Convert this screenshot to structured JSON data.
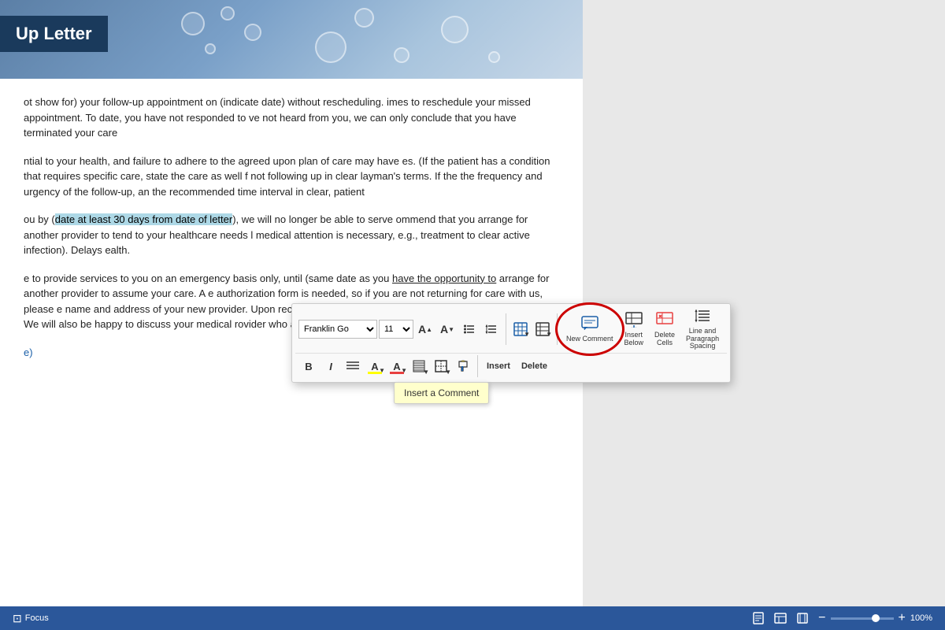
{
  "document": {
    "title": "Up Letter",
    "header_bg": "steelblue",
    "paragraphs": [
      "ot show for) your follow-up appointment on (indicate date) without rescheduling. imes to reschedule your missed appointment. To date, you have not responded to ve not heard from you, we can only conclude that you have terminated your care",
      "ntial to your health, and failure to adhere to the agreed upon plan of care may have es. (If the patient has a condition that requires specific care, state the care as well f not following up in clear layman's terms. If the the frequency and urgency of the follow-up, an the recommended time interval in clear, patient",
      "ou by (date at least 30 days from date of letter), we will no longer be able to serve ommend that you arrange for another provider to tend to your healthcare needs l medical attention is necessary, e.g., treatment to clear active infection). Delays ealth.",
      "e to provide services to you on an emergency basis only, until (same date as you have the opportunity to arrange for another provider to assume your care. A e authorization form is needed, so if you are not returning for care with us, please e name and address of your new provider. Upon receipt of your signed orward a copy of your medical record. We will also be happy to discuss your medical rovider who assumes your care.",
      "e)"
    ],
    "highlighted_phrase": "date at least 30 days from date of letter",
    "underline_phrases": [
      "have the opportunity to"
    ]
  },
  "toolbar": {
    "font_name": "Franklin Go",
    "font_size": "11",
    "buttons_row1": [
      {
        "id": "increase-font",
        "icon": "A↑",
        "label": ""
      },
      {
        "id": "decrease-font",
        "icon": "A↓",
        "label": ""
      },
      {
        "id": "bullets",
        "icon": "≡•",
        "label": ""
      },
      {
        "id": "line-spacing",
        "icon": "≡↕",
        "label": ""
      }
    ],
    "buttons_row1_right": [
      {
        "id": "table-insert",
        "icon": "⊞",
        "label": ""
      },
      {
        "id": "table-options",
        "icon": "⊟",
        "label": ""
      },
      {
        "id": "new-comment",
        "icon": "💬",
        "label": "New Comment",
        "highlighted": true
      },
      {
        "id": "insert-below",
        "icon": "⊕↓",
        "label": "Insert Below"
      },
      {
        "id": "delete-cells",
        "icon": "✕⊡",
        "label": "Delete Cells"
      },
      {
        "id": "line-paragraph-spacing",
        "icon": "≡↕",
        "label": "Line and Paragraph Spacing"
      }
    ],
    "buttons_row2": [
      {
        "id": "bold",
        "label": "B"
      },
      {
        "id": "italic",
        "label": "I"
      },
      {
        "id": "align",
        "label": "≡"
      },
      {
        "id": "highlight",
        "label": "A✏"
      },
      {
        "id": "font-color",
        "label": "A"
      },
      {
        "id": "shading",
        "label": "▨"
      },
      {
        "id": "borders",
        "label": "⊞"
      },
      {
        "id": "format-paint",
        "label": "🖌"
      }
    ],
    "buttons_action": [
      {
        "id": "insert-btn",
        "label": "Insert"
      },
      {
        "id": "delete-btn",
        "label": "Delete"
      }
    ]
  },
  "tooltip": {
    "text": "Insert a Comment"
  },
  "status_bar": {
    "focus_label": "Focus",
    "zoom_percent": "100%",
    "zoom_value": 100
  }
}
